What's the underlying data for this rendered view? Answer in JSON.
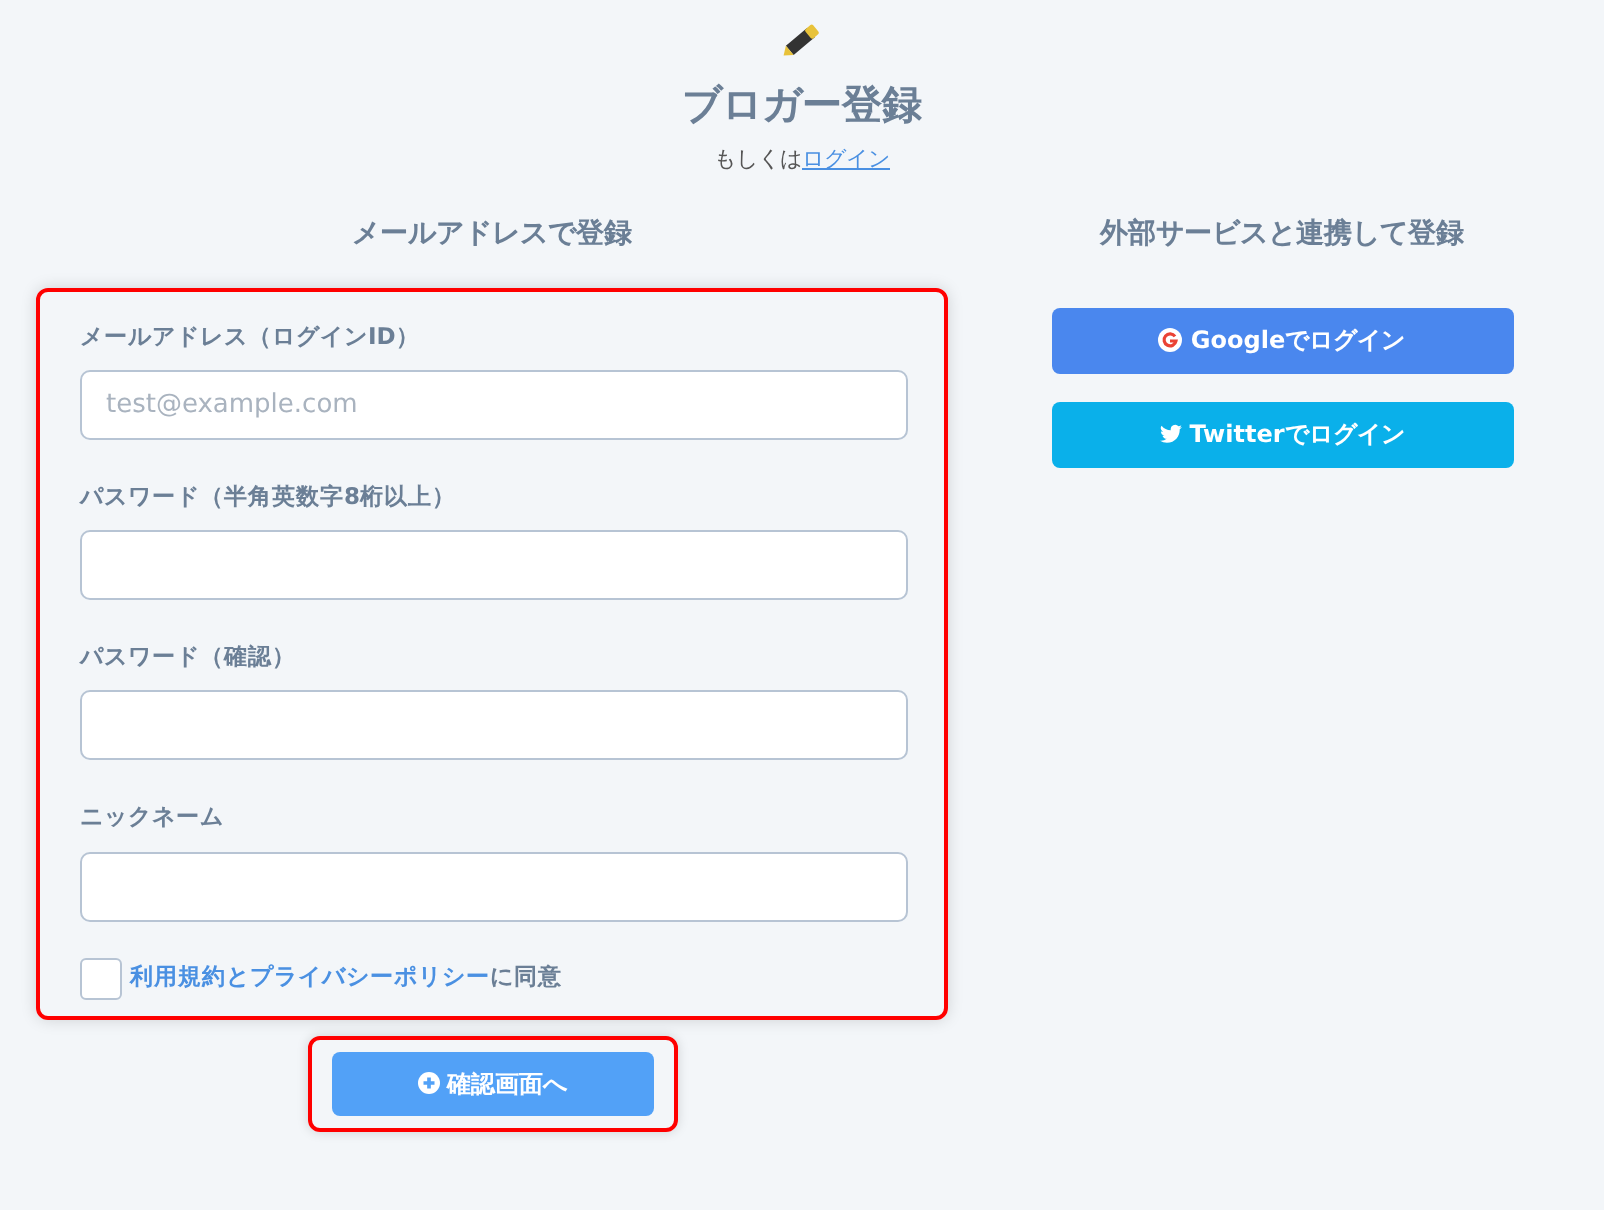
{
  "header": {
    "title": "ブロガー登録",
    "prefix": "もしくは",
    "login_link": "ログイン"
  },
  "email_section": {
    "heading": "メールアドレスで登録",
    "fields": [
      {
        "label": "メールアドレス（ログインID）",
        "placeholder": "test@example.com"
      },
      {
        "label": "パスワード（半角英数字8桁以上）"
      },
      {
        "label": "パスワード（確認）"
      },
      {
        "label": "ニックネーム"
      }
    ],
    "agree": {
      "link": "利用規約とプライバシーポリシー",
      "text": "に同意",
      "checked": false
    },
    "submit": "確認画面へ"
  },
  "external_section": {
    "heading": "外部サービスと連携して登録",
    "buttons": [
      {
        "kind": "google",
        "label": "Googleでログイン"
      },
      {
        "kind": "twitter",
        "label": "Twitterでログイン"
      }
    ]
  }
}
